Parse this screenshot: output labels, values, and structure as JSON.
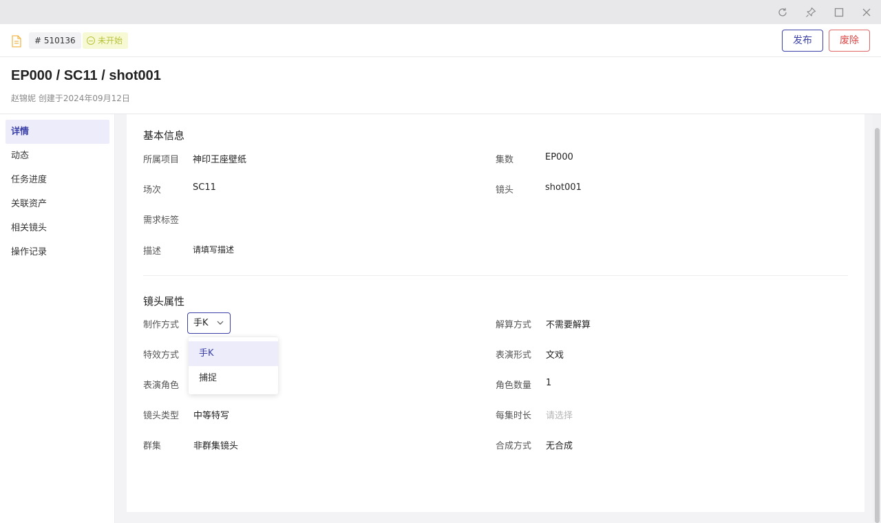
{
  "window": {
    "controls": [
      "refresh-icon",
      "pin-icon",
      "maximize-icon",
      "close-icon"
    ]
  },
  "header": {
    "task_id": "# 510136",
    "status": "未开始",
    "publish_label": "发布",
    "abandon_label": "废除",
    "colors": {
      "accent": "#3a40a8",
      "danger": "#e04848",
      "status": "#b8c23a"
    }
  },
  "title": {
    "path": "EP000 / SC11 / shot001",
    "meta": "赵锦妮 创建于2024年09月12日"
  },
  "sidebar": {
    "items": [
      {
        "label": "详情",
        "active": true
      },
      {
        "label": "动态"
      },
      {
        "label": "任务进度"
      },
      {
        "label": "关联资产"
      },
      {
        "label": "相关镜头"
      },
      {
        "label": "操作记录"
      }
    ]
  },
  "basic": {
    "title": "基本信息",
    "project_label": "所属项目",
    "project_value": "神印王座壁纸",
    "episode_label": "集数",
    "episode_value": "EP000",
    "scene_label": "场次",
    "scene_value": "SC11",
    "shot_label": "镜头",
    "shot_value": "shot001",
    "tags_label": "需求标签",
    "desc_label": "描述",
    "desc_value": "请填写描述"
  },
  "attrs": {
    "title": "镜头属性",
    "make_label": "制作方式",
    "make_value": "手K",
    "solve_label": "解算方式",
    "solve_value": "不需要解算",
    "vfx_label": "特效方式",
    "perf_label": "表演形式",
    "perf_value": "文戏",
    "role_label": "表演角色",
    "count_label": "角色数量",
    "count_value": "1",
    "type_label": "镜头类型",
    "type_value": "中等特写",
    "duration_label": "每集时长",
    "duration_placeholder": "请选择",
    "crowd_label": "群集",
    "crowd_value": "非群集镜头",
    "comp_label": "合成方式",
    "comp_value": "无合成"
  },
  "dropdown": {
    "options": [
      {
        "label": "手K",
        "selected": true
      },
      {
        "label": "捕捉"
      }
    ]
  }
}
